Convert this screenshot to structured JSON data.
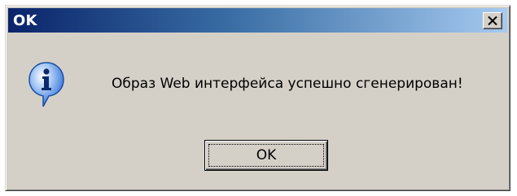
{
  "window": {
    "title": "OK",
    "close_icon": "close-icon"
  },
  "dialog": {
    "icon": "info-icon",
    "message": "Образ Web интерфейса успешно сгенерирован!",
    "ok_label": "OK"
  },
  "colors": {
    "titlebar_start": "#0a246a",
    "titlebar_end": "#a6caf0",
    "face": "#d4d0c8",
    "info_icon": "#2f6fd6"
  }
}
